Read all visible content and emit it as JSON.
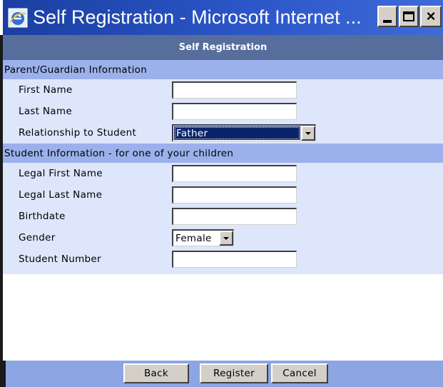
{
  "window": {
    "title": "Self Registration - Microsoft Internet ...",
    "controls": {
      "minimize": "minimize",
      "maximize": "maximize",
      "close": "×"
    }
  },
  "page": {
    "header": "Self Registration",
    "parent_section": {
      "title": "Parent/Guardian Information",
      "fields": {
        "first_name": {
          "label": "First Name",
          "value": ""
        },
        "last_name": {
          "label": "Last Name",
          "value": ""
        },
        "relationship": {
          "label": "Relationship to Student",
          "value": "Father"
        }
      }
    },
    "student_section": {
      "title": "Student Information - for one of your children",
      "fields": {
        "legal_first_name": {
          "label": "Legal First Name",
          "value": ""
        },
        "legal_last_name": {
          "label": "Legal Last Name",
          "value": ""
        },
        "birthdate": {
          "label": "Birthdate",
          "value": ""
        },
        "gender": {
          "label": "Gender",
          "value": "Female"
        },
        "student_number": {
          "label": "Student Number",
          "value": ""
        }
      }
    },
    "buttons": {
      "back": "Back",
      "register": "Register",
      "cancel": "Cancel"
    }
  },
  "colors": {
    "title_bar": "#2b56c8",
    "header_bar": "#576e9c",
    "section_bar": "#9cb1eb",
    "form_background": "#dde6fb",
    "footer_bar": "#8ca5e3",
    "selection": "#0a246a"
  },
  "icons": [
    "internet-explorer-icon",
    "minimize-icon",
    "maximize-icon",
    "close-icon",
    "dropdown-arrow-icon"
  ]
}
